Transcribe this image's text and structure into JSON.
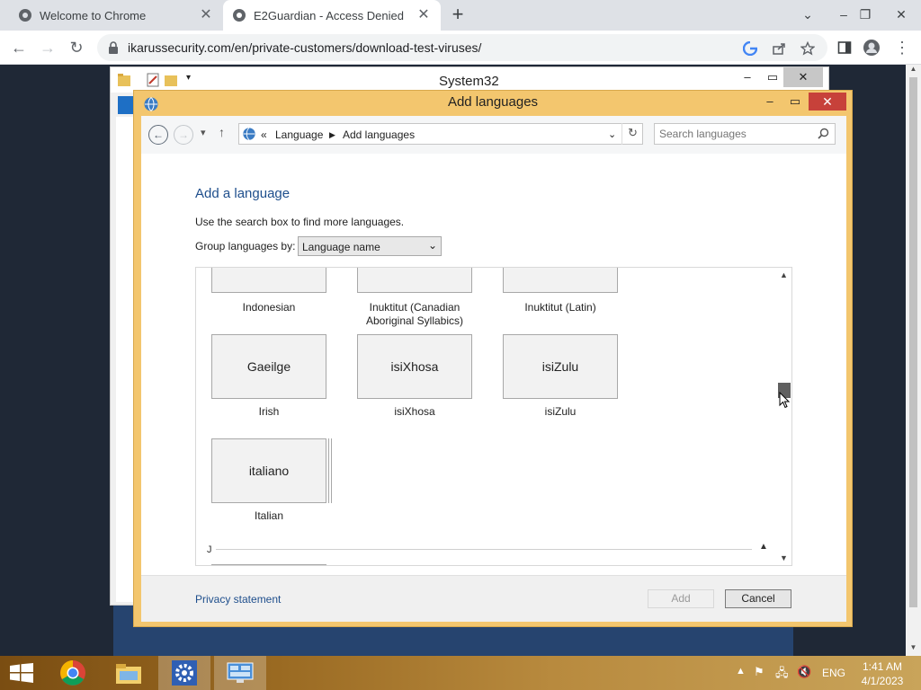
{
  "browser": {
    "tabs": [
      {
        "title": "Welcome to Chrome",
        "active": false
      },
      {
        "title": "E2Guardian - Access Denied",
        "active": true
      }
    ],
    "url": "ikarussecurity.com/en/private-customers/download-test-viruses/",
    "accent": "#1a73e8"
  },
  "system32_window": {
    "title": "System32"
  },
  "dialog": {
    "title": "Add languages",
    "breadcrumb": {
      "prefix": "«",
      "items": [
        "Language",
        "Add languages"
      ]
    },
    "search_placeholder": "Search languages",
    "heading": "Add a language",
    "hint": "Use the search box to find more languages.",
    "group_label": "Group languages by:",
    "group_value": "Language name",
    "languages_partial": [
      {
        "label": "Indonesian"
      },
      {
        "label_line1": "Inuktitut (Canadian",
        "label_line2": "Aboriginal Syllabics)"
      },
      {
        "label": "Inuktitut (Latin)"
      }
    ],
    "languages": [
      {
        "native": "Gaeilge",
        "label": "Irish"
      },
      {
        "native": "isiXhosa",
        "label": "isiXhosa"
      },
      {
        "native": "isiZulu",
        "label": "isiZulu"
      },
      {
        "native": "italiano",
        "label": "Italian"
      }
    ],
    "next_section": "J",
    "privacy": "Privacy statement",
    "add_label": "Add",
    "cancel_label": "Cancel"
  },
  "taskbar": {
    "language": "ENG",
    "time": "1:41 AM",
    "date": "4/1/2023"
  }
}
